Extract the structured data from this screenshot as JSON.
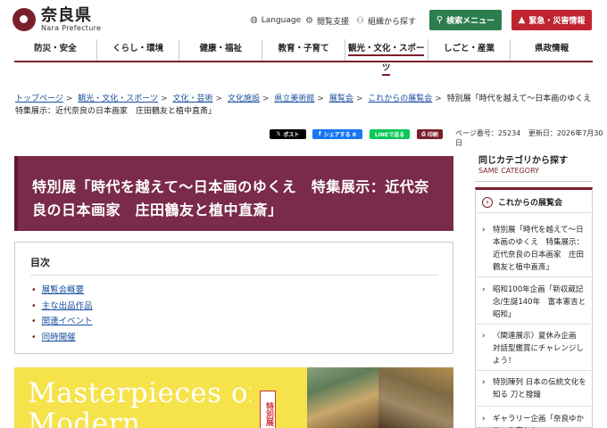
{
  "header": {
    "logo_jp": "奈良県",
    "logo_en": "Nara Prefecture",
    "language": "Language",
    "reading_support": "閲覧支援",
    "org_search": "組織から探す",
    "search_menu": "検索メニュー",
    "emergency": "緊急・災害情報",
    "colors": {
      "brand": "#7a1f2b",
      "search_btn": "#2e7d4f",
      "emergency_btn": "#c0242f"
    }
  },
  "gnav": [
    "防災・安全",
    "くらし・環境",
    "健康・福祉",
    "教育・子育て",
    "観光・文化・スポーツ",
    "しごと・産業",
    "県政情報"
  ],
  "breadcrumb": {
    "links": [
      "トップページ",
      "観光・文化・スポーツ",
      "文化・芸術",
      "文化施設",
      "県立美術館",
      "展覧会",
      "これからの展覧会"
    ],
    "current": "特別展「時代を越えて〜日本画のゆくえ　特集展示：近代奈良の日本画家　庄田鶴友と植中直斎」"
  },
  "share": {
    "x_post": "ポスト",
    "fb_share": "シェアする 0",
    "line_send": "LINEで送る",
    "print": "印刷"
  },
  "meta": {
    "page_number": "ページ番号：25234",
    "updated": "更新日：2026年7月30日"
  },
  "main": {
    "title": "特別展「時代を越えて〜日本画のゆくえ　特集展示：近代奈良の日本画家　庄田鶴友と植中直斎」",
    "toc_heading": "目次",
    "toc_items": [
      "展覧会概要",
      "主な出品作品",
      "関連イベント",
      "同時開催"
    ],
    "poster_text_1": "Masterpieces of",
    "poster_text_2": "Modern",
    "poster_label": "特別展"
  },
  "side": {
    "heading": "同じカテゴリから探す",
    "sub": "SAME CATEGORY",
    "category": "これからの展覧会",
    "items": [
      "特別展「時代を越えて〜日本画のゆくえ　特集展示：近代奈良の日本画家　庄田鶴友と植中直斎」",
      "昭和100年企画「新収蔵記念/生誕140年　富本憲吉と昭和」",
      "〈関連展示〉夏休み企画　対話型鑑賞にチャレンジしよう！",
      "特別陳列 日本の伝統文化を知る 刀と撥鐘",
      "ギャラリー企画「奈良ゆかりの作家たち」"
    ]
  }
}
